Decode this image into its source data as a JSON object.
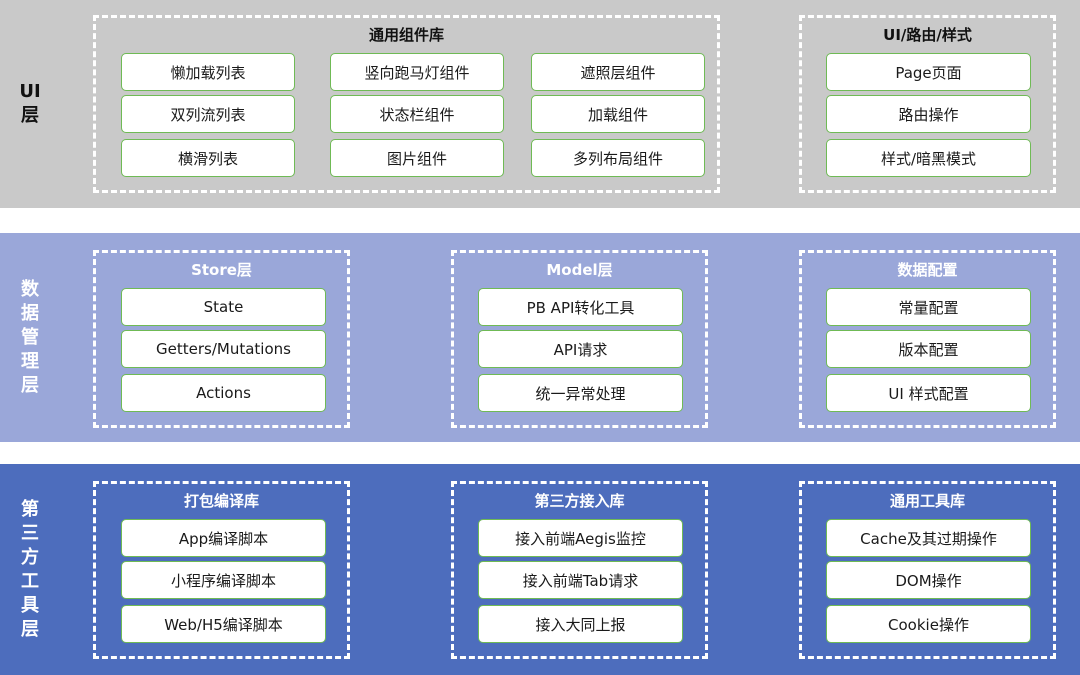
{
  "layers": [
    {
      "label": "UI\n层",
      "groups": [
        {
          "title": "通用组件库",
          "items": [
            "懒加载列表",
            "竖向跑马灯组件",
            "遮照层组件",
            "双列流列表",
            "状态栏组件",
            "加载组件",
            "横滑列表",
            "图片组件",
            "多列布局组件"
          ]
        },
        {
          "title": "UI/路由/样式",
          "items": [
            "Page页面",
            "路由操作",
            "样式/暗黑模式"
          ]
        }
      ]
    },
    {
      "label": "数\n据\n管\n理\n层",
      "groups": [
        {
          "title": "Store层",
          "items": [
            "State",
            "Getters/Mutations",
            "Actions"
          ]
        },
        {
          "title": "Model层",
          "items": [
            "PB API转化工具",
            "API请求",
            "统一异常处理"
          ]
        },
        {
          "title": "数据配置",
          "items": [
            "常量配置",
            "版本配置",
            "UI 样式配置"
          ]
        }
      ]
    },
    {
      "label": "第\n三\n方\n工\n具\n层",
      "groups": [
        {
          "title": "打包编译库",
          "items": [
            "App编译脚本",
            "小程序编译脚本",
            "Web/H5编译脚本"
          ]
        },
        {
          "title": "第三方接入库",
          "items": [
            "接入前端Aegis监控",
            "接入前端Tab请求",
            "接入大同上报"
          ]
        },
        {
          "title": "通用工具库",
          "items": [
            "Cache及其过期操作",
            "DOM操作",
            "Cookie操作"
          ]
        }
      ]
    }
  ]
}
